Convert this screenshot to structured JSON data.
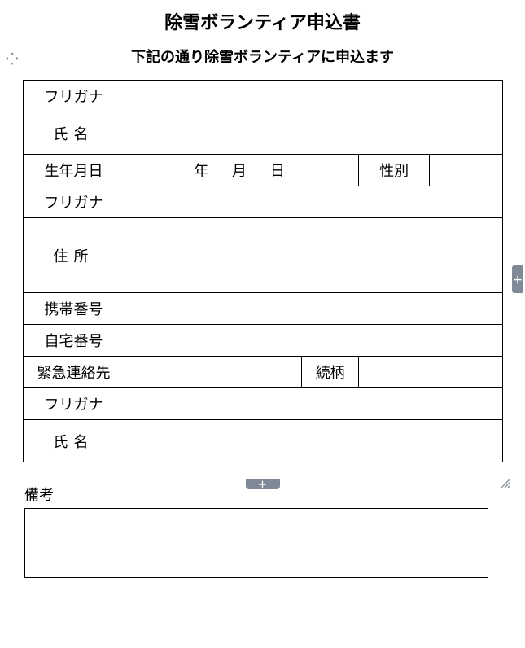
{
  "title": "除雪ボランティア申込書",
  "subtitle": "下記の通り除雪ボランティアに申込ます",
  "labels": {
    "furigana1": "フリガナ",
    "name1": "氏名",
    "birthdate": "生年月日",
    "birthdate_units": "年　月　日",
    "gender": "性別",
    "furigana2": "フリガナ",
    "address": "住所",
    "mobile": "携帯番号",
    "home": "自宅番号",
    "emergency": "緊急連絡先",
    "relationship": "続柄",
    "furigana3": "フリガナ",
    "name2": "氏名",
    "remarks": "備考"
  },
  "values": {
    "furigana1": "",
    "name1": "",
    "birth_year": "",
    "birth_month": "",
    "birth_day": "",
    "gender": "",
    "furigana2": "",
    "address": "",
    "mobile": "",
    "home": "",
    "emergency": "",
    "relationship": "",
    "furigana3": "",
    "name2": "",
    "remarks": ""
  },
  "icons": {
    "plus": "＋"
  }
}
